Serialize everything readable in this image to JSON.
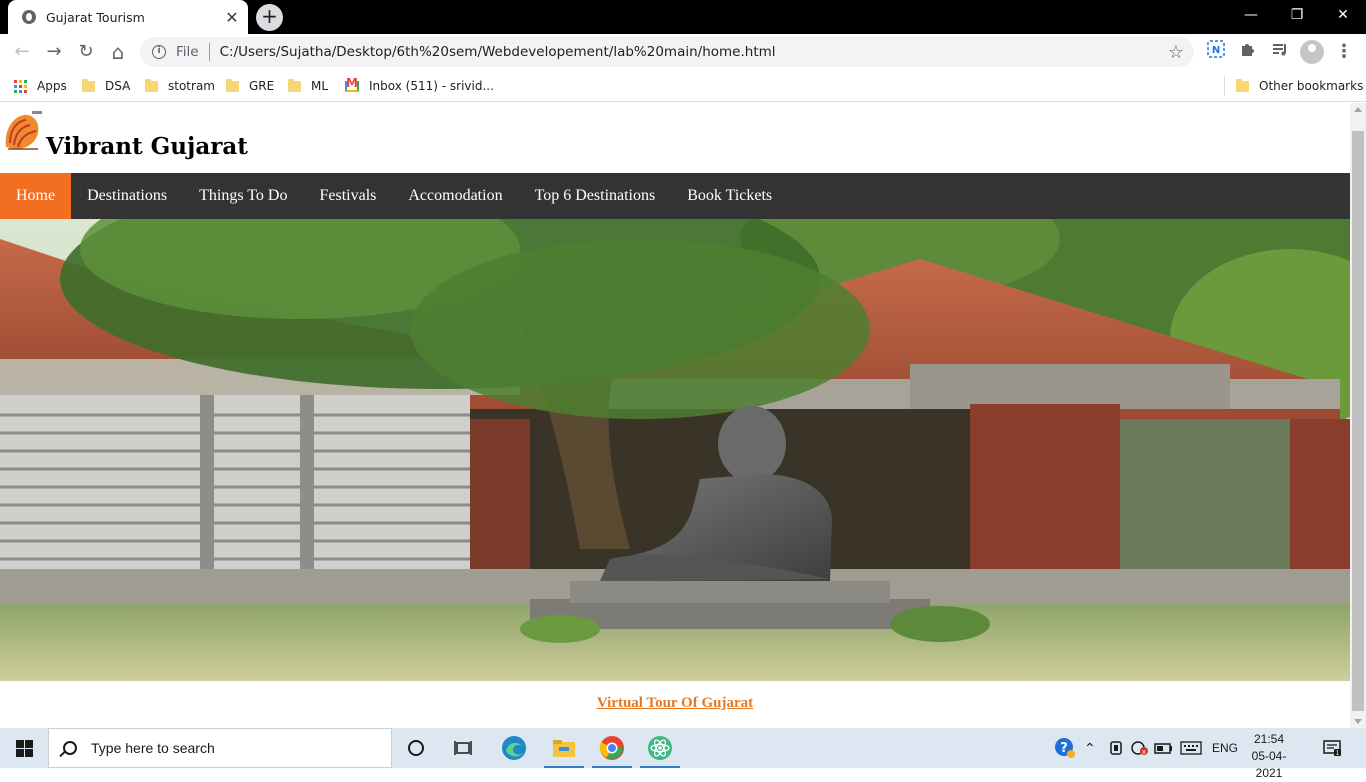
{
  "browser": {
    "tab_title": "Gujarat Tourism",
    "tab_close": "✕",
    "new_tab": "+",
    "window_controls": {
      "minimize": "—",
      "restore": "❐",
      "close": "✕"
    },
    "nav": {
      "back": "←",
      "forward": "→",
      "reload": "↻",
      "home": "⌂"
    },
    "address": {
      "scheme_label": "File",
      "url": "C:/Users/Sujatha/Desktop/6th%20sem/Webdevelopement/lab%20main/home.html"
    },
    "bookmarks": [
      {
        "label": "Apps",
        "icon": "apps-grid-icon"
      },
      {
        "label": "DSA",
        "icon": "folder-icon"
      },
      {
        "label": "stotram",
        "icon": "folder-icon"
      },
      {
        "label": "GRE",
        "icon": "folder-icon"
      },
      {
        "label": "ML",
        "icon": "folder-icon"
      },
      {
        "label": "Inbox (511) - srivid...",
        "icon": "gmail-icon"
      }
    ],
    "other_bookmarks": "Other bookmarks"
  },
  "site": {
    "title": "Vibrant Gujarat",
    "nav": [
      {
        "label": "Home",
        "active": true
      },
      {
        "label": "Destinations",
        "active": false
      },
      {
        "label": "Things To Do",
        "active": false
      },
      {
        "label": "Festivals",
        "active": false
      },
      {
        "label": "Accomodation",
        "active": false
      },
      {
        "label": "Top 6 Destinations",
        "active": false
      },
      {
        "label": "Book Tickets",
        "active": false
      }
    ],
    "tour_link": "Virtual Tour Of Gujarat",
    "accent_color": "#f26f22",
    "nav_bg_color": "#333333"
  },
  "taskbar": {
    "search_placeholder": "Type here to search",
    "language": "ENG",
    "time": "21:54",
    "date": "05-04-2021"
  }
}
